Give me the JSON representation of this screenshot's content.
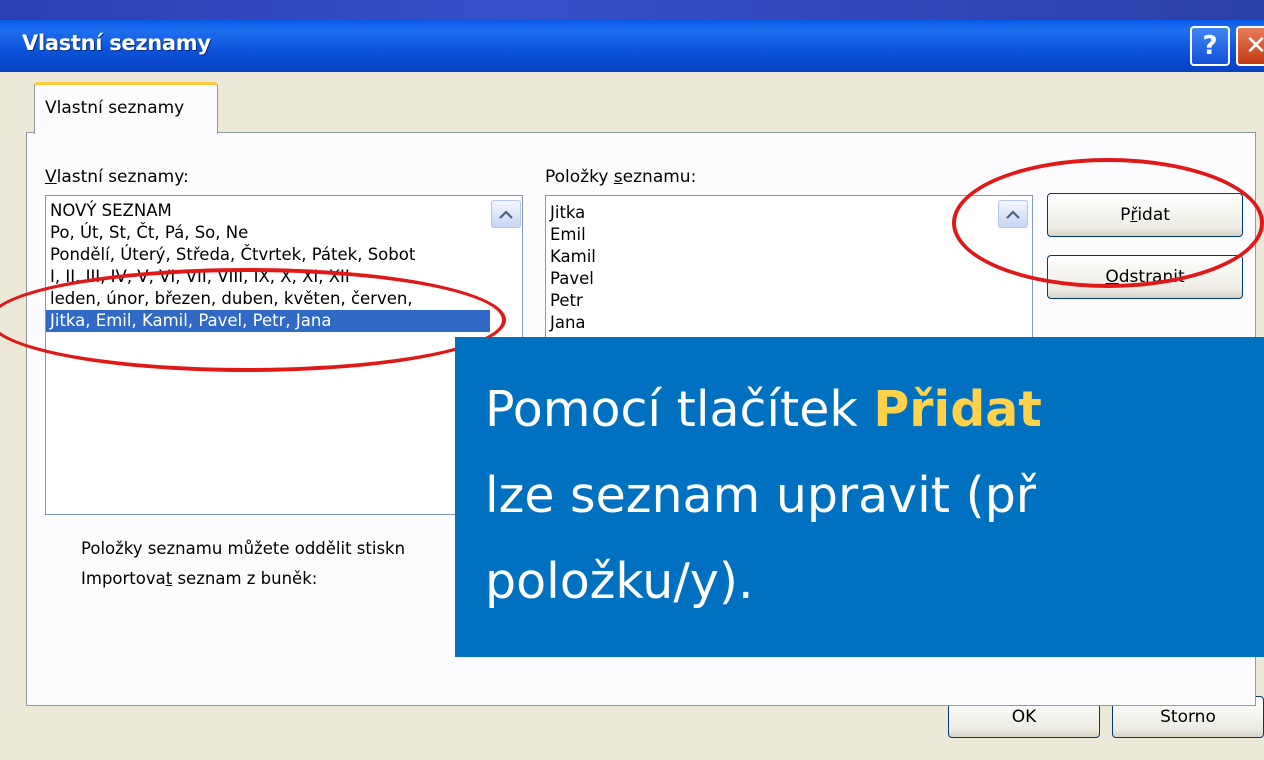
{
  "dialog": {
    "title": "Vlastní seznamy",
    "help_glyph": "?",
    "close_glyph": "✕"
  },
  "tab": {
    "label": "Vlastní seznamy"
  },
  "left_list": {
    "label_first": "V",
    "label_rest": "lastní seznamy:",
    "items": [
      "NOVÝ SEZNAM",
      "Po, Út, St, Čt, Pá, So, Ne",
      "Pondělí, Úterý, Středa, Čtvrtek, Pátek, Sobot",
      "I, II, III, IV, V, VI, VII, VIII, IX, X, XI, XII",
      "leden, únor, březen, duben, květen, červen,",
      "Jitka, Emil, Kamil, Pavel, Petr, Jana"
    ],
    "selected_index": 5
  },
  "right_list": {
    "label_before": "Položky ",
    "label_u": "s",
    "label_after": "eznamu:",
    "items": [
      "Jitka",
      "Emil",
      "Kamil",
      "Pavel",
      "Petr",
      "Jana"
    ]
  },
  "buttons": {
    "add_before": "P",
    "add_u": "ř",
    "add_after": "idat",
    "remove_u": "O",
    "remove_after": "dstranit",
    "ok": "OK",
    "cancel": "Storno"
  },
  "hints": {
    "separator_hint": "Položky seznamu můžete oddělit stiskn",
    "import_before": "Importova",
    "import_u": "t",
    "import_after": " seznam z buněk:"
  },
  "callout": {
    "line1_pre": "Pomocí tlačítek ",
    "line1_bold": "Přidat",
    "line2": "lze seznam upravit (př",
    "line3": "položku/y)."
  },
  "colors": {
    "callout_bg": "#0070c0",
    "callout_highlight": "#ffd24a",
    "ellipse": "#e01818",
    "selection": "#316ac5"
  }
}
